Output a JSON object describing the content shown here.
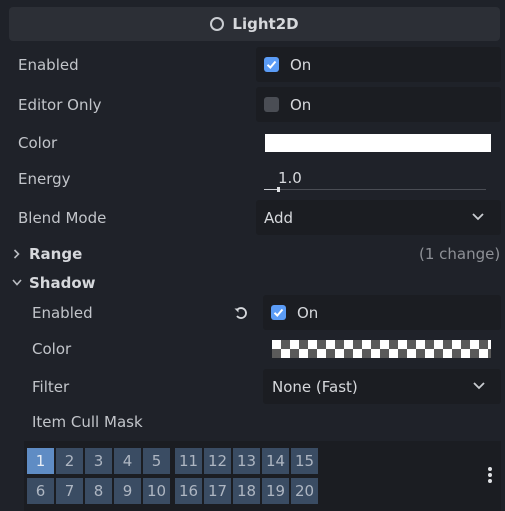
{
  "header": {
    "title": "Light2D",
    "icon": "circle-icon"
  },
  "props": {
    "enabled": {
      "label": "Enabled",
      "value": "On",
      "checked": true
    },
    "editor_only": {
      "label": "Editor Only",
      "value": "On",
      "checked": false
    },
    "color": {
      "label": "Color",
      "swatch": "#ffffff"
    },
    "energy": {
      "label": "Energy",
      "value": "1.0"
    },
    "blend_mode": {
      "label": "Blend Mode",
      "value": "Add"
    }
  },
  "range": {
    "label": "Range",
    "changes": "(1 change)"
  },
  "shadow": {
    "label": "Shadow",
    "enabled": {
      "label": "Enabled",
      "value": "On",
      "checked": true
    },
    "color": {
      "label": "Color"
    },
    "filter": {
      "label": "Filter",
      "value": "None (Fast)"
    },
    "cull": {
      "label": "Item Cull Mask"
    }
  },
  "cull_mask": {
    "row1": [
      "1",
      "2",
      "3",
      "4",
      "5",
      "11",
      "12",
      "13",
      "14",
      "15"
    ],
    "row2": [
      "6",
      "7",
      "8",
      "9",
      "10",
      "16",
      "17",
      "18",
      "19",
      "20"
    ],
    "selected": [
      "1"
    ]
  },
  "colors": {
    "accent": "#5b9cf6",
    "cell": "#3a4c63",
    "cell_selected": "#5f8cc4"
  }
}
